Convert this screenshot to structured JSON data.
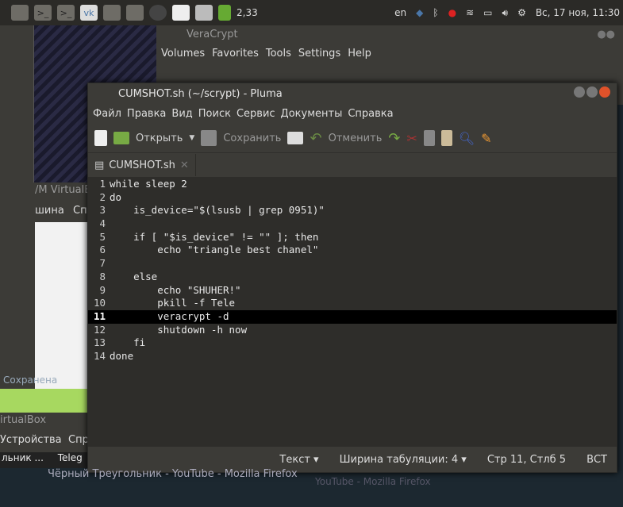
{
  "top_panel": {
    "battery_indicator": "2,33",
    "keyboard_layout": "en",
    "clock": "Вс, 17 ноя, 11:30"
  },
  "veracrypt": {
    "title": "VeraCrypt",
    "menu": [
      "Volumes",
      "Favorites",
      "Tools",
      "Settings",
      "Help"
    ]
  },
  "virtualbox": {
    "title_fragment": "/M VirtualB",
    "menu_fragment": "шина",
    "menu_fragment2": "Сп",
    "title2": "irtualBox",
    "menu2": "Устройства",
    "menu2b": "Спр",
    "item": "Сохранена"
  },
  "taskbar": {
    "item1": "льник ...",
    "item2": "Teleg"
  },
  "pluma": {
    "title": "CUMSHOT.sh (~/scrypt) - Pluma",
    "menu": [
      "Файл",
      "Правка",
      "Вид",
      "Поиск",
      "Сервис",
      "Документы",
      "Справка"
    ],
    "toolbar": {
      "open": "Открыть",
      "save": "Сохранить",
      "undo": "Отменить"
    },
    "tab": "CUMSHOT.sh",
    "lines": [
      "while sleep 2",
      "do",
      "    is_device=\"$(lsusb | grep 0951)\"",
      "",
      "    if [ \"$is_device\" != \"\" ]; then",
      "        echo \"triangle best chanel\"",
      "",
      "    else",
      "        echo \"SHUHER!\"",
      "        pkill -f Tele",
      "        veracrypt -d",
      "        shutdown -h now",
      "    fi",
      "done"
    ],
    "current_line": 11,
    "status": {
      "language": "Текст",
      "tab_width": "Ширина табуляции: 4",
      "position": "Стр 11, Стлб 5",
      "mode": "ВСТ"
    }
  },
  "tooltip": {
    "text": "Чёрный Треугольник - YouTube - Mozilla Firefox",
    "text2": "YouTube - Mozilla Firefox"
  }
}
